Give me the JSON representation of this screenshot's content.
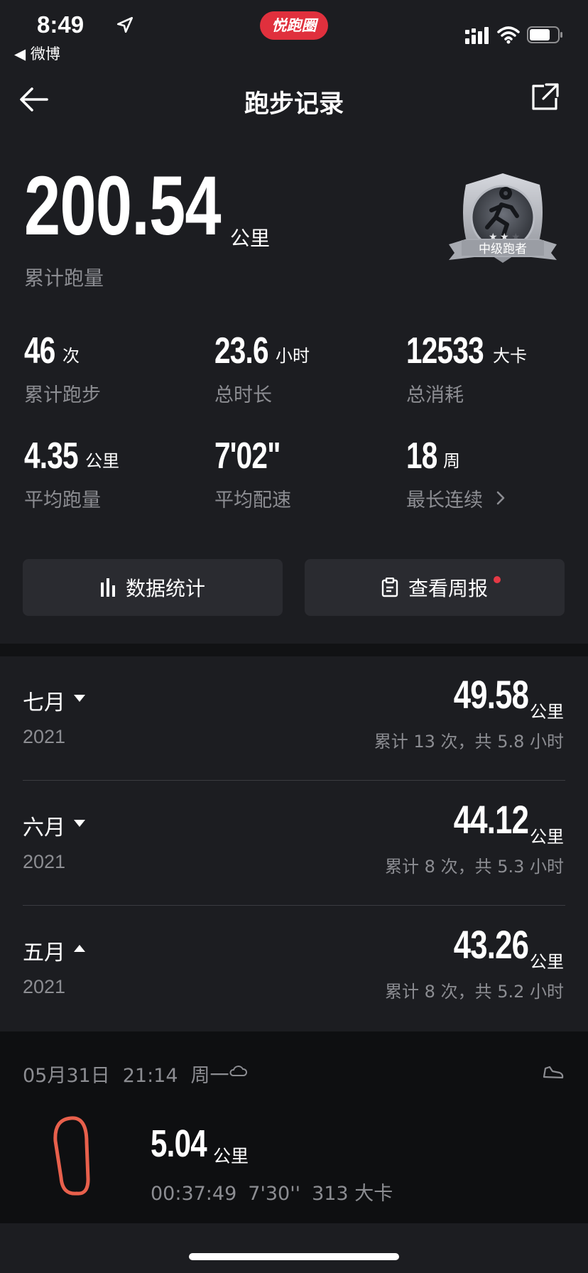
{
  "status": {
    "time": "8:49",
    "back_app": "◀ 微博",
    "pill": "悦跑圈"
  },
  "nav": {
    "title": "跑步记录"
  },
  "total": {
    "value": "200.54",
    "unit": "公里",
    "label": "累计跑量"
  },
  "badge": {
    "text": "中级跑者"
  },
  "stats": [
    {
      "value": "46",
      "unit": "次",
      "label": "累计跑步"
    },
    {
      "value": "23.6",
      "unit": "小时",
      "label": "总时长"
    },
    {
      "value": "12533",
      "unit": "大卡",
      "label": "总消耗"
    },
    {
      "value": "4.35",
      "unit": "公里",
      "label": "平均跑量"
    },
    {
      "value": "7'02\"",
      "unit": "",
      "label": "平均配速"
    },
    {
      "value": "18",
      "unit": "周",
      "label": "最长连续"
    }
  ],
  "buttons": {
    "stats": "数据统计",
    "weekly": "查看周报"
  },
  "months": [
    {
      "month": "七月",
      "year": "2021",
      "value": "49.58",
      "unit": "公里",
      "summary": "累计 13 次，共 5.8 小时",
      "expanded": false
    },
    {
      "month": "六月",
      "year": "2021",
      "value": "44.12",
      "unit": "公里",
      "summary": "累计 8 次，共 5.3 小时",
      "expanded": false
    },
    {
      "month": "五月",
      "year": "2021",
      "value": "43.26",
      "unit": "公里",
      "summary": "累计 8 次，共 5.2 小时",
      "expanded": true
    }
  ],
  "record": {
    "date": "05月31日",
    "time": "21:14",
    "weekday": "周一",
    "distance": "5.04",
    "unit": "公里",
    "duration": "00:37:49",
    "pace": "7'30''",
    "calories": "313 大卡"
  },
  "colors": {
    "accent": "#e0303d",
    "background": "#1c1d21",
    "muted": "#8c8d92",
    "route": "#e8604c"
  }
}
